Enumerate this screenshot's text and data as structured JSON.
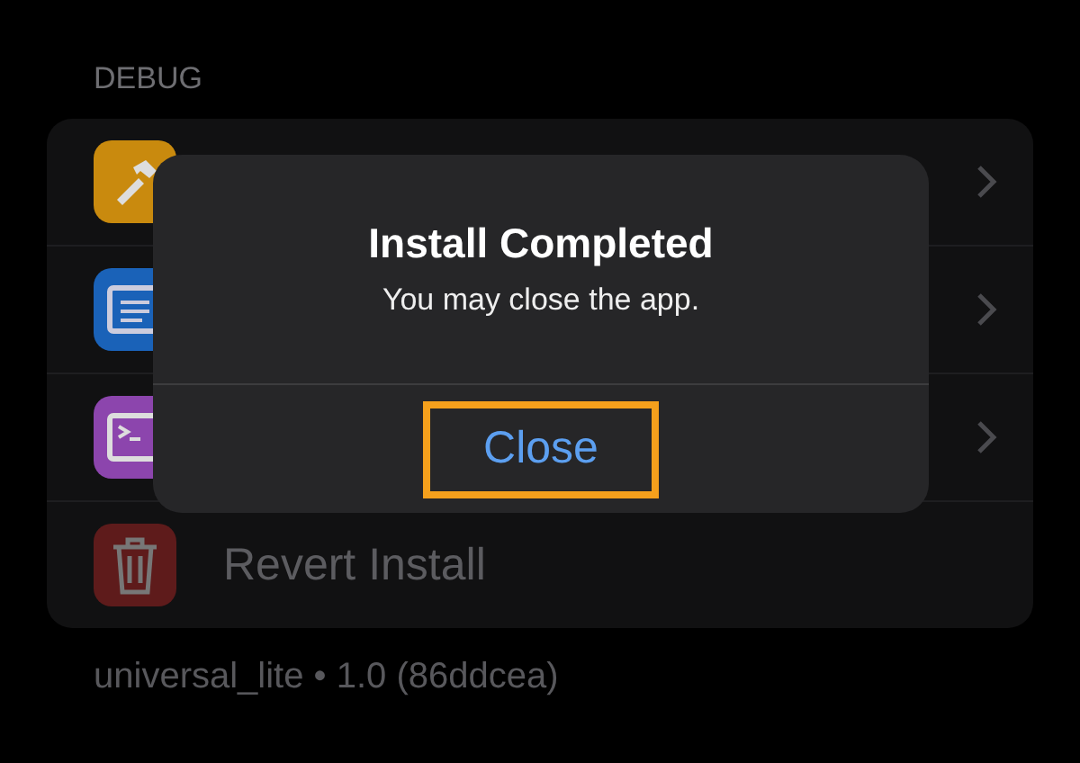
{
  "section": {
    "title": "DEBUG"
  },
  "rows": [
    {
      "color": "#c98a0e",
      "chevron": true
    },
    {
      "color": "#1a62b8",
      "chevron": true
    },
    {
      "color": "#8c45ad",
      "chevron": true
    },
    {
      "color": "#5e1b1b",
      "label": "Revert Install",
      "chevron": false
    }
  ],
  "footer": "universal_lite • 1.0 (86ddcea)",
  "alert": {
    "title": "Install Completed",
    "message": "You may close the app.",
    "button": "Close",
    "highlighted": true
  }
}
